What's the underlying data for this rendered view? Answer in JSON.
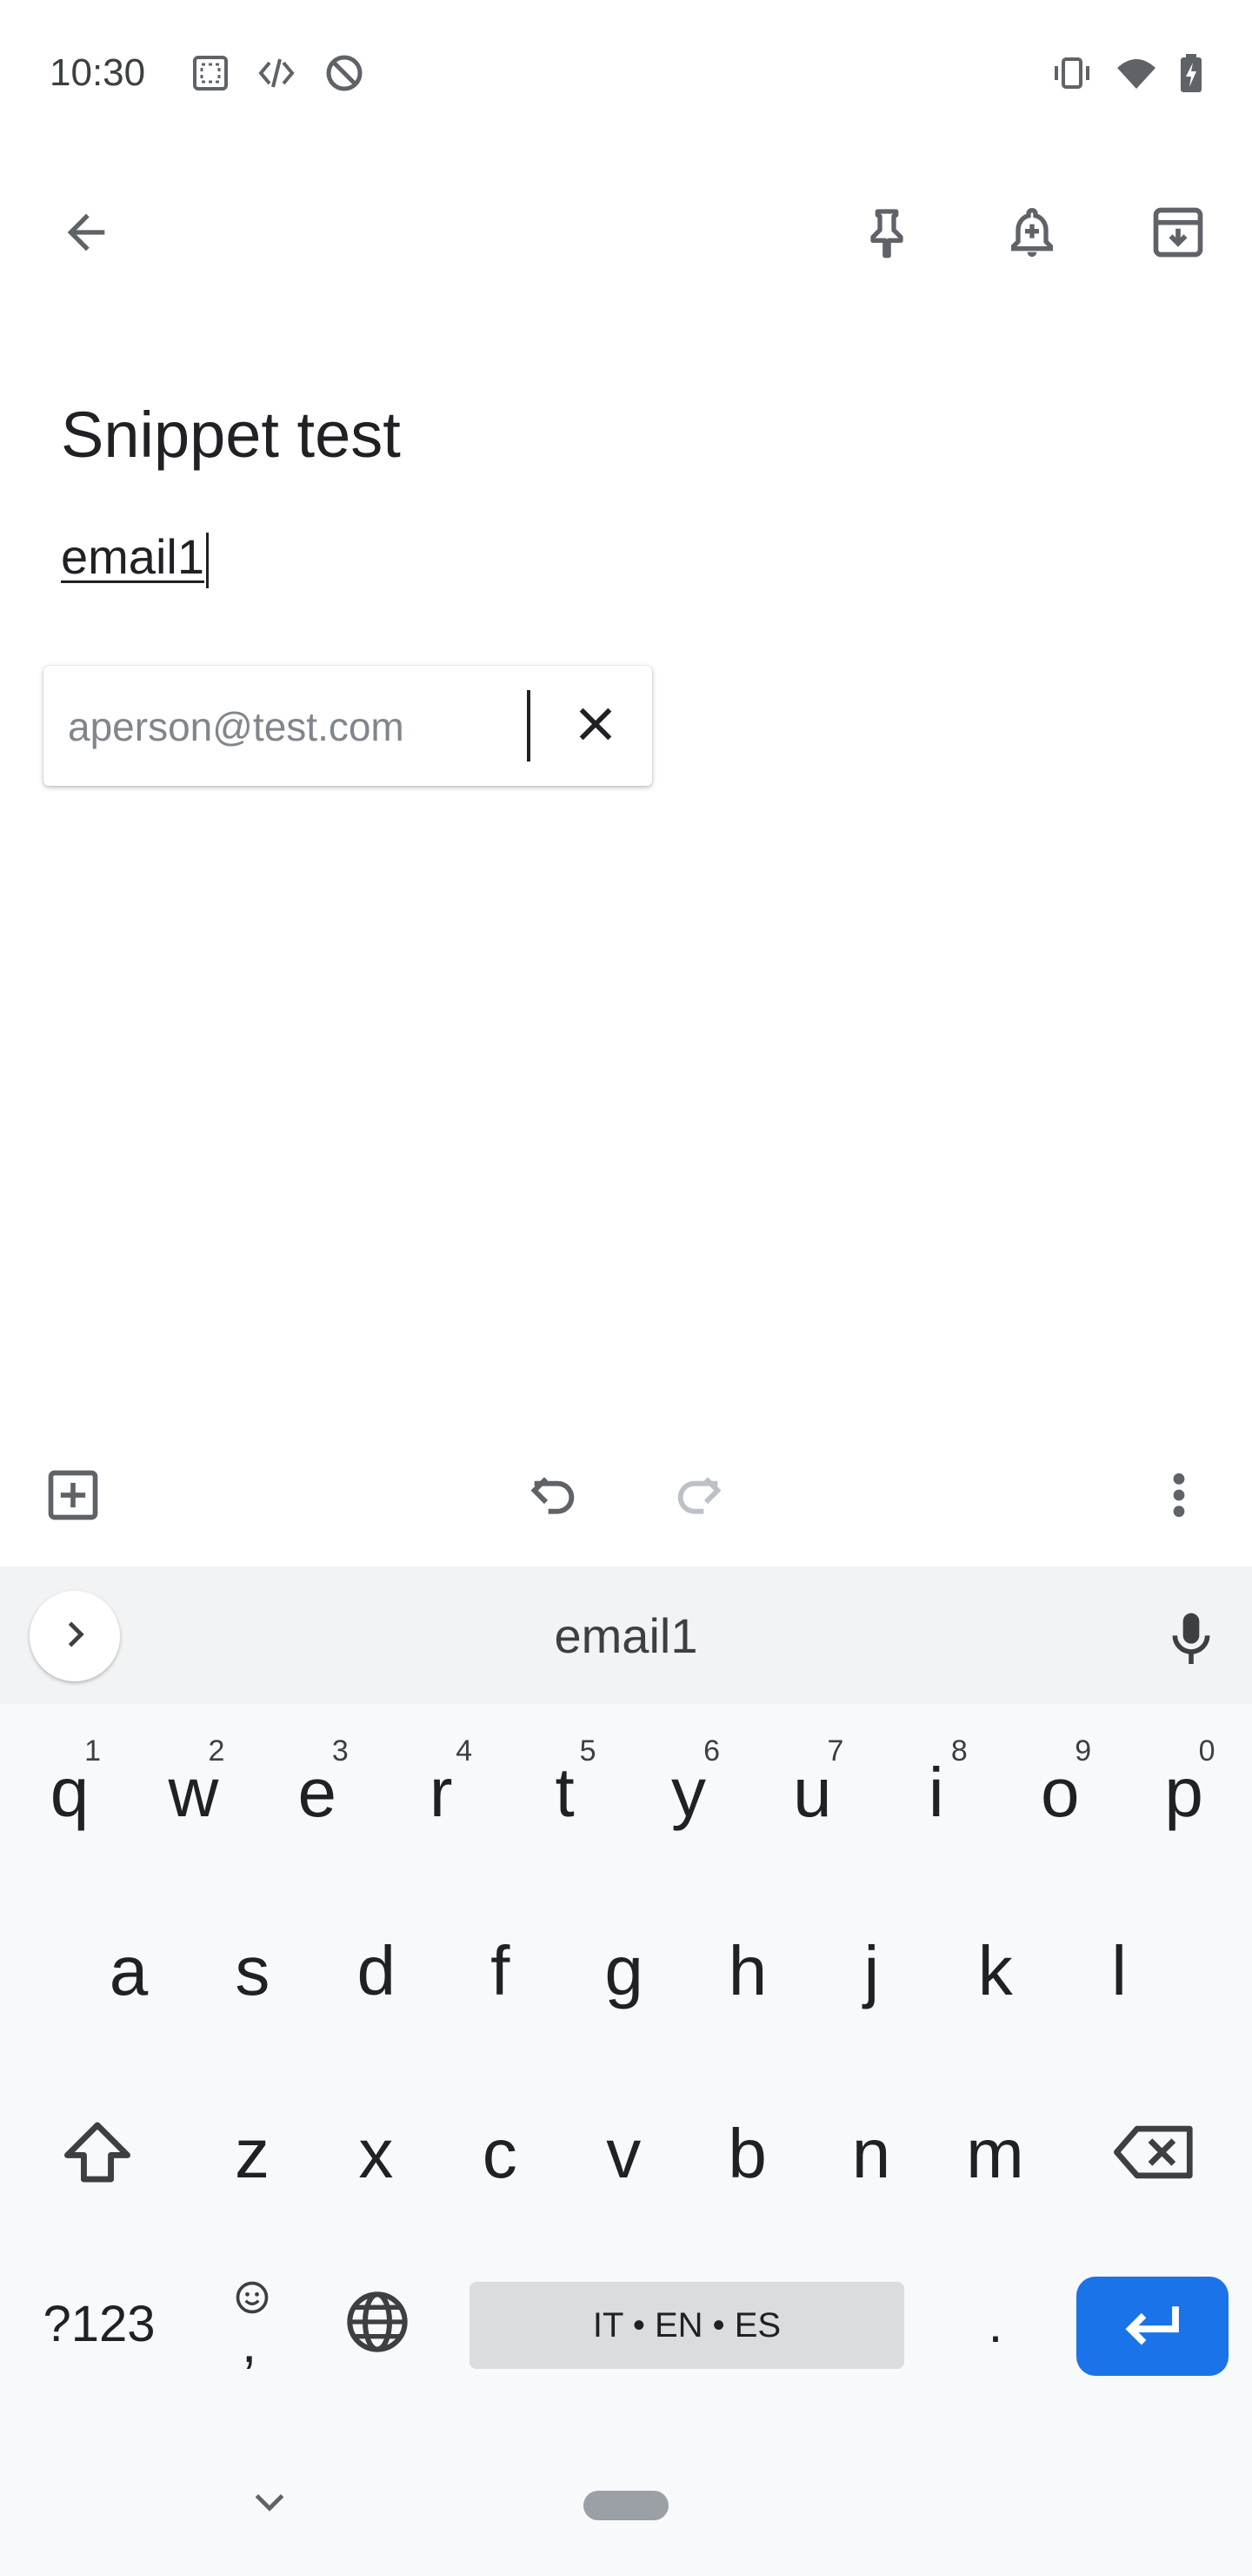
{
  "status_bar": {
    "time": "10:30",
    "left_icons": [
      "screenshot-icon",
      "developer-icon",
      "do-not-disturb-icon"
    ],
    "right_icons": [
      "vibrate-icon",
      "wifi-icon",
      "battery-charging-icon"
    ]
  },
  "toolbar": {
    "back_icon": "arrow-back-icon",
    "actions": [
      "pin-icon",
      "add-reminder-icon",
      "archive-icon"
    ]
  },
  "note": {
    "title": "Snippet test",
    "body": "email1"
  },
  "snippet_popup": {
    "value": "aperson@test.com",
    "close_icon": "close-icon"
  },
  "editor_bar": {
    "icons": [
      "add-box-icon",
      "undo-icon",
      "redo-icon",
      "more-vert-icon"
    ]
  },
  "keyboard": {
    "suggestion": "email1",
    "row1": [
      {
        "key": "q",
        "hint": "1"
      },
      {
        "key": "w",
        "hint": "2"
      },
      {
        "key": "e",
        "hint": "3"
      },
      {
        "key": "r",
        "hint": "4"
      },
      {
        "key": "t",
        "hint": "5"
      },
      {
        "key": "y",
        "hint": "6"
      },
      {
        "key": "u",
        "hint": "7"
      },
      {
        "key": "i",
        "hint": "8"
      },
      {
        "key": "o",
        "hint": "9"
      },
      {
        "key": "p",
        "hint": "0"
      }
    ],
    "row2": [
      "a",
      "s",
      "d",
      "f",
      "g",
      "h",
      "j",
      "k",
      "l"
    ],
    "row3": [
      "z",
      "x",
      "c",
      "v",
      "b",
      "n",
      "m"
    ],
    "symbols_label": "?123",
    "comma_label": ",",
    "period_label": ".",
    "space_label": "IT • EN • ES"
  },
  "colors": {
    "accent": "#1a73e8",
    "keyboard_bg": "#f8f9fa",
    "suggestion_bg": "#f1f3f4"
  }
}
